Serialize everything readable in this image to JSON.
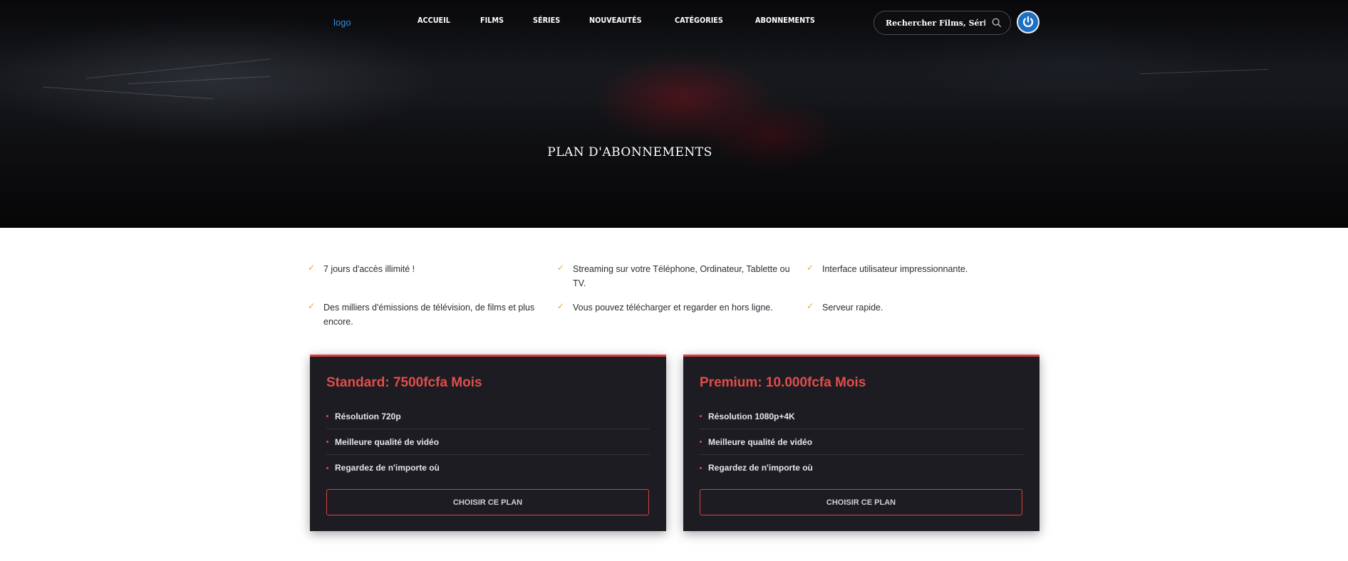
{
  "header": {
    "logo": "logo",
    "nav": [
      "ACCUEIL",
      "FILMS",
      "SÉRIES",
      "NOUVEAUTÉS",
      "CATÉGORIES",
      "ABONNEMENTS"
    ],
    "search_placeholder": "Rechercher Films, Séries...",
    "icons": {
      "search": "search-icon",
      "power": "power-icon"
    }
  },
  "hero": {
    "title": "PLAN D'ABONNEMENTS"
  },
  "features": [
    "7 jours d'accès illimité !",
    "Streaming sur votre Téléphone, Ordinateur, Tablette ou TV.",
    "Interface utilisateur impressionnante.",
    "Des milliers d'émissions de télévision, de films et plus encore.",
    "Vous pouvez télécharger et regarder en hors ligne.",
    "Serveur rapide."
  ],
  "plans": [
    {
      "title": "Standard: 7500fcfa Mois",
      "features": [
        "Résolution 720p",
        "Meilleure qualité de vidéo",
        "Regardez de n'importe où"
      ],
      "button": "CHOISIR CE PLAN"
    },
    {
      "title": "Premium: 10.000fcfa Mois",
      "features": [
        "Résolution 1080p+4K",
        "Meilleure qualité de vidéo",
        "Regardez de n'importe où"
      ],
      "button": "CHOISIR CE PLAN"
    }
  ],
  "colors": {
    "accent": "#d9413f",
    "check": "#e6a631",
    "logo": "#2f8fe6",
    "card_bg": "#1d1c22"
  }
}
